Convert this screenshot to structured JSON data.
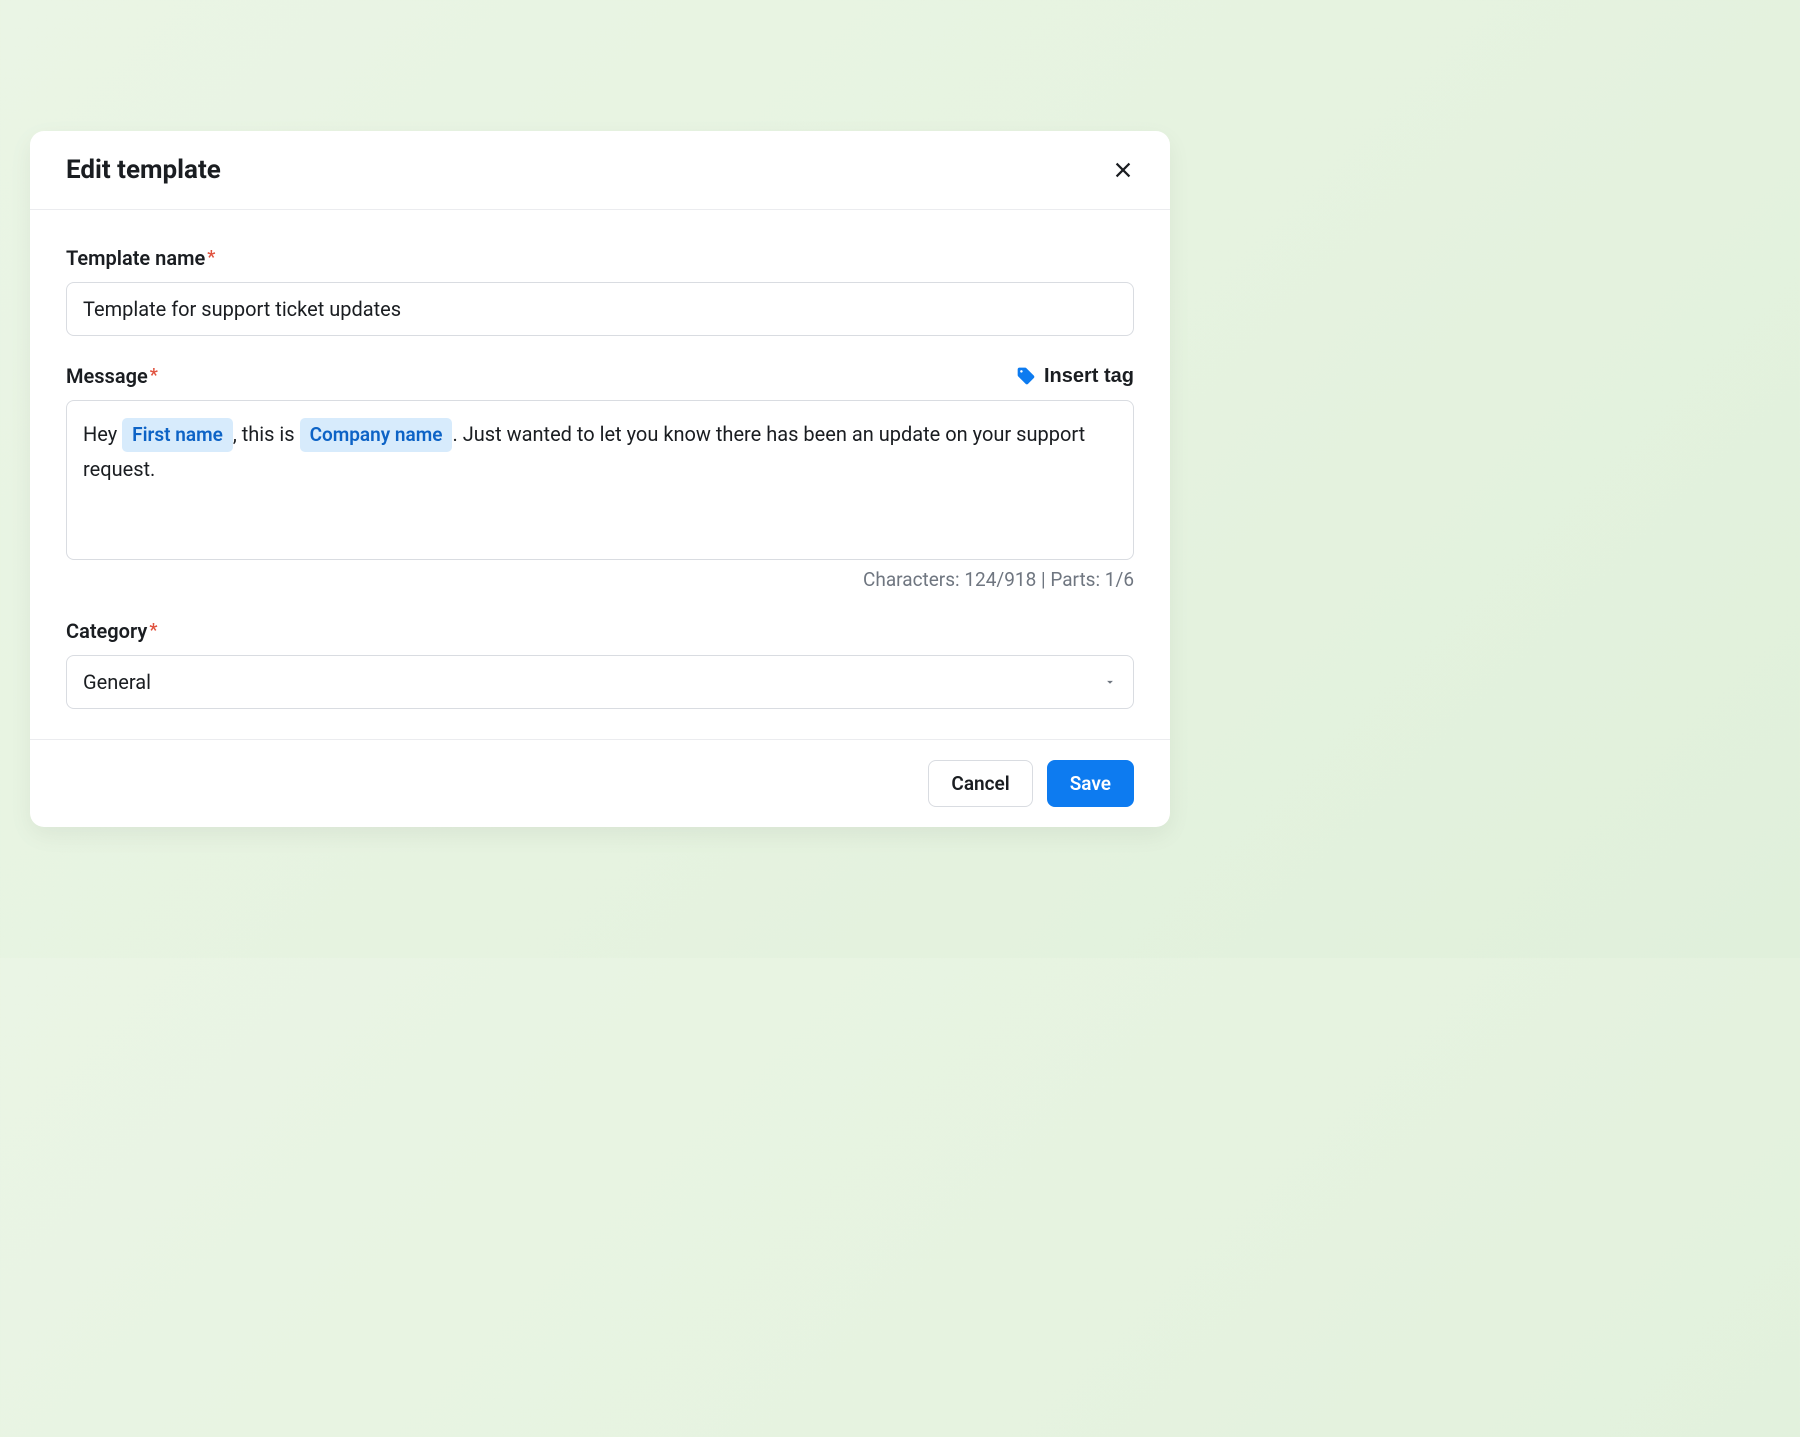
{
  "modal": {
    "title": "Edit template"
  },
  "fields": {
    "template_name": {
      "label": "Template name",
      "value": "Template for support ticket updates"
    },
    "message": {
      "label": "Message",
      "insert_tag_label": "Insert tag",
      "parts": {
        "text1": "Hey ",
        "tag1": "First name",
        "text2": ", this is ",
        "tag2": "Company name",
        "text3": ". Just wanted to let you know there has been an update on your support request."
      },
      "counter": "Characters: 124/918  |  Parts: 1/6"
    },
    "category": {
      "label": "Category",
      "value": "General"
    }
  },
  "footer": {
    "cancel": "Cancel",
    "save": "Save"
  },
  "required_marker": "*"
}
